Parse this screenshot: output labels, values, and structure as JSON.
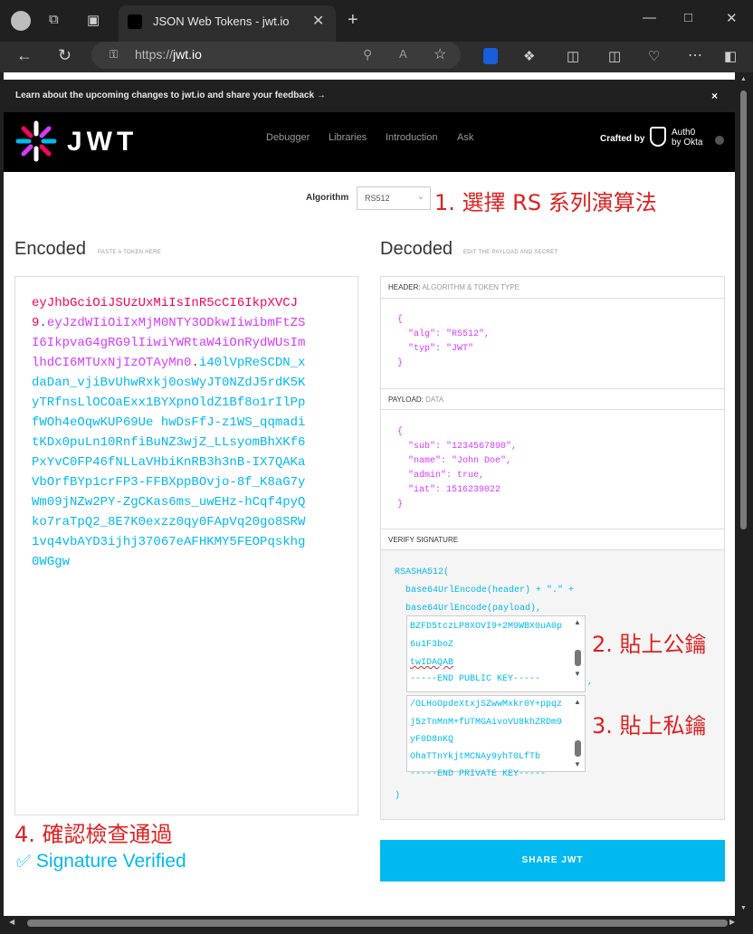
{
  "browser": {
    "tab_title": "JSON Web Tokens - jwt.io",
    "url_scheme": "https://",
    "url_host": "jwt.io"
  },
  "banner": {
    "text": "Learn about the upcoming changes to jwt.io and share your feedback →",
    "close": "×"
  },
  "header": {
    "logo": "JWT",
    "nav": [
      "Debugger",
      "Libraries",
      "Introduction",
      "Ask"
    ],
    "crafted": "Crafted by",
    "auth0_line1": "Auth0",
    "auth0_line2": "by Okta"
  },
  "algorithm": {
    "label": "Algorithm",
    "value": "RS512"
  },
  "annotations": {
    "a1": "1. 選擇 RS 系列演算法",
    "a2": "2. 貼上公鑰",
    "a3": "3. 貼上私鑰",
    "a4": "4. 確認檢查通過"
  },
  "encoded": {
    "title": "Encoded",
    "subtitle": "PASTE A TOKEN HERE",
    "header_part": "eyJhbGciOiJSUzUxMiIsInR5cCI6IkpXVCJ9",
    "payload_part": "eyJzdWIiOiIxMjM0NTY3ODkwIiwibmFtZSI6IkpvaG4gRG9lIiwiYWRtaW4iOnRydWUsImlhdCI6MTUxNjIzOTAyMn0",
    "signature_part": "i40lVpReSCDN_xdaDan_vjiBvUhwRxkj0osWyJT0NZdJ5rdK5KyTRfnsLlOCOaExx1BYXpnOldZ1Bf8o1rIlPpfWOh4eOqwKUP69Ue hwDsFfJ-z1WS_qqmaditKDx0puLn10RnfiBuNZ3wjZ_LLsyomBhXKf6PxYvC0FP46fNLLaVHbiKnRB3h3nB-IX7QAKaVbOrfBYp1crFP3-FFBXppBOvjo-8f_K8aG7yWm09jNZw2PY-ZgCKas6ms_uwEHz-hCqf4pyQko7raTpQ2_8E7K0exzz0qy0FApVq20go8SRW1vq4vbAYD3ijhj37067eAFHKMY5FEOPqskhg0WGgw"
  },
  "decoded": {
    "title": "Decoded",
    "subtitle": "EDIT THE PAYLOAD AND SECRET",
    "header_label": "HEADER:",
    "header_sub": "ALGORITHM & TOKEN TYPE",
    "header_json": [
      "{",
      "  \"alg\": \"RS512\",",
      "  \"typ\": \"JWT\"",
      "}"
    ],
    "payload_label": "PAYLOAD:",
    "payload_sub": "DATA",
    "payload_json": [
      "{",
      "  \"sub\": \"1234567890\",",
      "  \"name\": \"John Doe\",",
      "  \"admin\": true,",
      "  \"iat\": 1516239022",
      "}"
    ],
    "verify_label": "VERIFY SIGNATURE",
    "verify_code": [
      "RSASHA512(",
      "  base64UrlEncode(header) + \".\" +",
      "  base64UrlEncode(payload),"
    ],
    "public_key": [
      "BZFD5tczLP8XOVI9+2M9WBX0uA0p",
      "6u1F3boZ",
      "twIDAQAB",
      "-----END PUBLIC KEY-----"
    ],
    "comma": ",",
    "private_key": [
      "/OLHoOpdeXtxjSZwwMxkr0Y+ppqz",
      "j5zTnMnM+fUTMGAivoVU8khZRDm9",
      "yF0D8nKQ",
      "OhaTTnYkjtMCNAy9yhT0LfTb",
      "-----END PRIVATE KEY-----"
    ],
    "close": ")"
  },
  "share_label": "SHARE JWT",
  "verified_text": "Signature Verified",
  "colors": {
    "header_part": "#fb015b",
    "payload_part": "#d63aff",
    "signature_part": "#00b9f1",
    "annotation": "#e02020"
  }
}
